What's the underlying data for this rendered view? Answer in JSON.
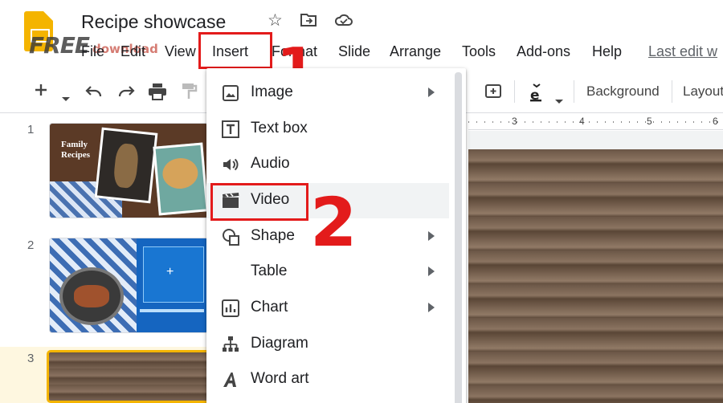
{
  "title_bar": {
    "doc_title": "Recipe showcase",
    "icons": [
      "star-icon",
      "move-to-folder-icon",
      "cloud-saved-icon"
    ],
    "watermark": "FREE",
    "watermark_small": "download"
  },
  "menu": {
    "items": [
      {
        "label": "File"
      },
      {
        "label": "Edit"
      },
      {
        "label": "View"
      },
      {
        "label": "Insert"
      },
      {
        "label": "Format"
      },
      {
        "label": "Slide"
      },
      {
        "label": "Arrange"
      },
      {
        "label": "Tools"
      },
      {
        "label": "Add-ons"
      },
      {
        "label": "Help"
      }
    ],
    "last_edit": "Last edit w"
  },
  "toolbar": {
    "background_label": "Background",
    "layout_label": "Layout"
  },
  "ruler": {
    "marks": [
      "3",
      "4",
      "5",
      "6"
    ]
  },
  "slides": {
    "numbers": [
      "1",
      "2",
      "3"
    ],
    "slide1_title_line1": "Family",
    "slide1_title_line2": "Recipes"
  },
  "insert_menu": {
    "items": [
      {
        "label": "Image",
        "icon": "image-icon",
        "submenu": true
      },
      {
        "label": "Text box",
        "icon": "text-box-icon",
        "submenu": false
      },
      {
        "label": "Audio",
        "icon": "audio-icon",
        "submenu": false
      },
      {
        "label": "Video",
        "icon": "video-icon",
        "submenu": false
      },
      {
        "label": "Shape",
        "icon": "shape-icon",
        "submenu": true
      },
      {
        "label": "Table",
        "icon": "",
        "submenu": true
      },
      {
        "label": "Chart",
        "icon": "chart-icon",
        "submenu": true
      },
      {
        "label": "Diagram",
        "icon": "diagram-icon",
        "submenu": false
      },
      {
        "label": "Word art",
        "icon": "word-art-icon",
        "submenu": false
      }
    ]
  },
  "annotations": {
    "step1": "1",
    "step2": "2"
  },
  "colors": {
    "annotation_red": "#e31b1b",
    "logo_yellow": "#f4b400",
    "selection": "#f4b400"
  }
}
